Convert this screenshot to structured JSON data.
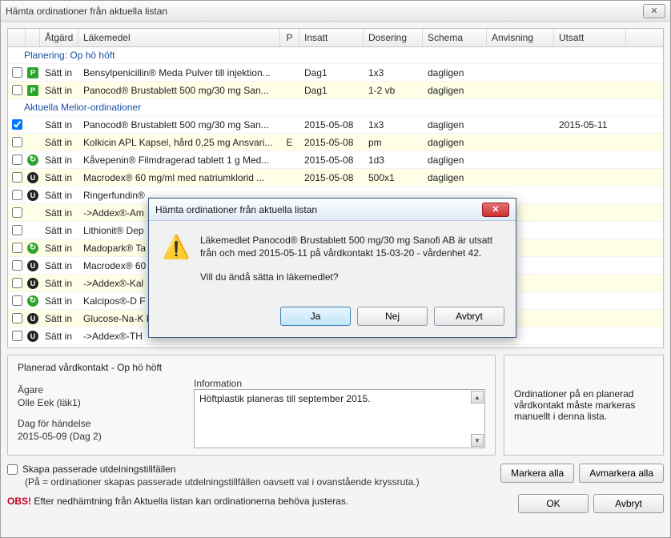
{
  "window": {
    "title": "Hämta ordinationer från aktuella listan"
  },
  "columns": {
    "atgard": "Åtgärd",
    "lakemedel": "Läkemedel",
    "p": "P",
    "insatt": "Insatt",
    "dosering": "Dosering",
    "schema": "Schema",
    "anvisning": "Anvisning",
    "utsatt": "Utsatt"
  },
  "groups": {
    "planering": "Planering: Op hö höft",
    "aktuella": "Aktuella Melior-ordinationer"
  },
  "rows": [
    {
      "group": 0,
      "alt": false,
      "chk": false,
      "icon": "P",
      "act": "Sätt in",
      "med": "Bensylpenicillin® Meda Pulver till injektion...",
      "p": "",
      "ins": "Dag1",
      "dos": "1x3",
      "sch": "dagligen",
      "anv": "",
      "uts": ""
    },
    {
      "group": 0,
      "alt": true,
      "chk": false,
      "icon": "P",
      "act": "Sätt in",
      "med": "Panocod® Brustablett 500 mg/30 mg San...",
      "p": "",
      "ins": "Dag1",
      "dos": "1-2 vb",
      "sch": "dagligen",
      "anv": "",
      "uts": ""
    },
    {
      "group": 1,
      "alt": false,
      "chk": true,
      "icon": "",
      "act": "Sätt in",
      "med": "Panocod® Brustablett 500 mg/30 mg San...",
      "p": "",
      "ins": "2015-05-08",
      "dos": "1x3",
      "sch": "dagligen",
      "anv": "",
      "uts": "2015-05-11"
    },
    {
      "group": 1,
      "alt": true,
      "chk": false,
      "icon": "",
      "act": "Sätt in",
      "med": "Kolkicin APL Kapsel, hård 0,25 mg Ansvari...",
      "p": "E",
      "ins": "2015-05-08",
      "dos": "pm",
      "sch": "dagligen",
      "anv": "",
      "uts": ""
    },
    {
      "group": 1,
      "alt": false,
      "chk": false,
      "icon": "Ur",
      "act": "Sätt in",
      "med": "Kåvepenin® Filmdragerad tablett 1 g Med...",
      "p": "",
      "ins": "2015-05-08",
      "dos": "1d3",
      "sch": "dagligen",
      "anv": "",
      "uts": ""
    },
    {
      "group": 1,
      "alt": true,
      "chk": false,
      "icon": "U",
      "act": "Sätt in",
      "med": "Macrodex® 60 mg/ml med natriumklorid ...",
      "p": "",
      "ins": "2015-05-08",
      "dos": "500x1",
      "sch": "dagligen",
      "anv": "",
      "uts": ""
    },
    {
      "group": 1,
      "alt": false,
      "chk": false,
      "icon": "U",
      "act": "Sätt in",
      "med": "Ringerfundin® ...",
      "p": "",
      "ins": "",
      "dos": "",
      "sch": "",
      "anv": "",
      "uts": ""
    },
    {
      "group": 1,
      "alt": true,
      "chk": false,
      "icon": "",
      "act": "Sätt in",
      "med": "->Addex®-Am",
      "p": "",
      "ins": "",
      "dos": "",
      "sch": "",
      "anv": "",
      "uts": ""
    },
    {
      "group": 1,
      "alt": false,
      "chk": false,
      "icon": "",
      "act": "Sätt in",
      "med": "Lithionit® Dep",
      "p": "",
      "ins": "",
      "dos": "",
      "sch": "",
      "anv": "",
      "uts": ""
    },
    {
      "group": 1,
      "alt": true,
      "chk": false,
      "icon": "Ur",
      "act": "Sätt in",
      "med": "Madopark® Ta",
      "p": "",
      "ins": "",
      "dos": "",
      "sch": "",
      "anv": "",
      "uts": ""
    },
    {
      "group": 1,
      "alt": false,
      "chk": false,
      "icon": "U",
      "act": "Sätt in",
      "med": "Macrodex® 60",
      "p": "",
      "ins": "",
      "dos": "",
      "sch": "",
      "anv": "",
      "uts": ""
    },
    {
      "group": 1,
      "alt": true,
      "chk": false,
      "icon": "U",
      "act": "Sätt in",
      "med": "->Addex®-Kal",
      "p": "",
      "ins": "",
      "dos": "",
      "sch": "",
      "anv": "",
      "uts": ""
    },
    {
      "group": 1,
      "alt": false,
      "chk": false,
      "icon": "Ur",
      "act": "Sätt in",
      "med": "Kalcipos®-D F",
      "p": "",
      "ins": "",
      "dos": "",
      "sch": "",
      "anv": "",
      "uts": ""
    },
    {
      "group": 1,
      "alt": true,
      "chk": false,
      "icon": "U",
      "act": "Sätt in",
      "med": "Glucose-Na-K E",
      "p": "",
      "ins": "",
      "dos": "",
      "sch": "",
      "anv": "",
      "uts": ""
    },
    {
      "group": 1,
      "alt": false,
      "chk": false,
      "icon": "U",
      "act": "Sätt in",
      "med": "->Addex®-TH",
      "p": "",
      "ins": "",
      "dos": "",
      "sch": "",
      "anv": "",
      "uts": ""
    }
  ],
  "panel": {
    "header": "Planerad vårdkontakt - Op hö höft",
    "owner_label": "Ägare",
    "owner_value": "Olle Eek (läk1)",
    "day_label": "Dag för händelse",
    "day_value": "2015-05-09 (Dag 2)",
    "info_label": "Information",
    "info_text": "Höftplastik planeras till september 2015."
  },
  "side_note": "Ordinationer på en planerad vårdkontakt måste markeras manuellt i denna lista.",
  "bottom": {
    "chk_label": "Skapa passerade utdelningstillfällen",
    "sub": "(På = ordinationer skapas passerade utdelningstillfällen oavsett val i ovanstående kryssruta.)",
    "obs_prefix": "OBS!",
    "obs_text": " Efter nedhämtning från Aktuella listan kan ordinationerna behöva justeras.",
    "markera_alla": "Markera alla",
    "avmarkera_alla": "Avmarkera alla",
    "ok": "OK",
    "avbryt": "Avbryt"
  },
  "modal": {
    "title": "Hämta ordinationer från aktuella listan",
    "line1": "Läkemedlet Panocod® Brustablett 500 mg/30 mg Sanofi AB är utsatt från och med 2015-05-11 på vårdkontakt 15-03-20 - vårdenhet 42.",
    "line2": "Vill du ändå sätta in läkemedlet?",
    "ja": "Ja",
    "nej": "Nej",
    "avbryt": "Avbryt"
  }
}
